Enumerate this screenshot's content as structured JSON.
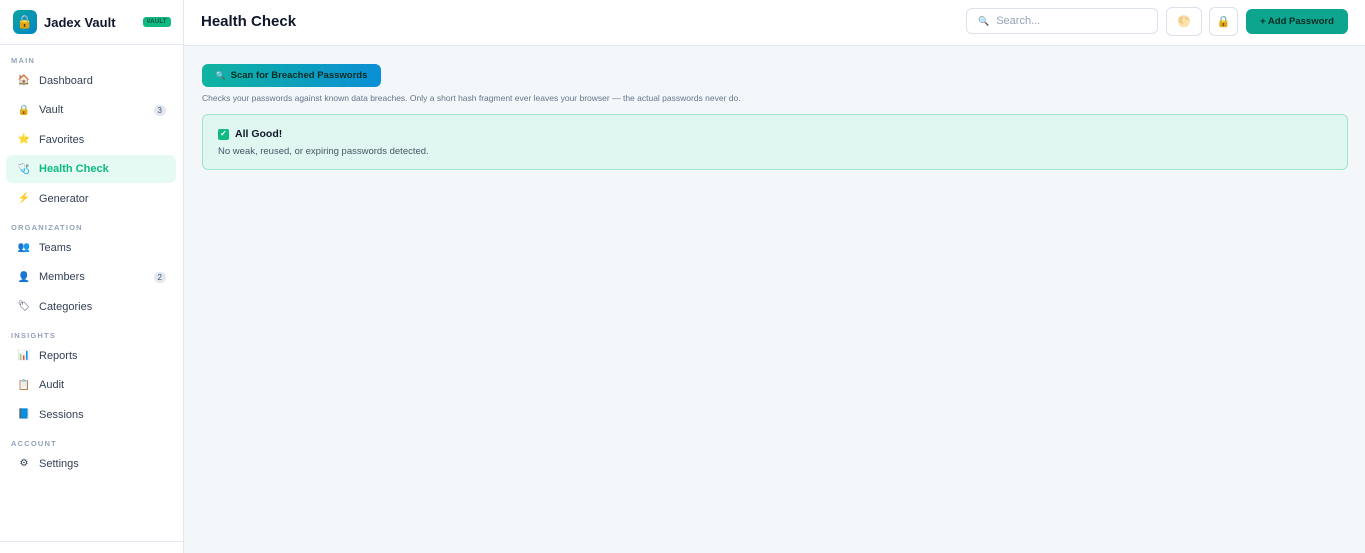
{
  "brand": {
    "name": "Jadex Vault",
    "badge": "VAULT",
    "logo_icon": "🔒"
  },
  "sidebar": {
    "sections": {
      "main": "MAIN",
      "organization": "ORGANIZATION",
      "insights": "INSIGHTS",
      "account": "ACCOUNT"
    },
    "items": {
      "dashboard": {
        "label": "Dashboard",
        "icon": "🏠"
      },
      "vault": {
        "label": "Vault",
        "icon": "🔒",
        "count": "3"
      },
      "favorites": {
        "label": "Favorites",
        "icon": "⭐"
      },
      "health_check": {
        "label": "Health Check",
        "icon": "🩺"
      },
      "generator": {
        "label": "Generator",
        "icon": "⚡"
      },
      "teams": {
        "label": "Teams",
        "icon": "👥"
      },
      "members": {
        "label": "Members",
        "icon": "👤",
        "count": "2"
      },
      "categories": {
        "label": "Categories",
        "icon": "🏷"
      },
      "reports": {
        "label": "Reports",
        "icon": "📊"
      },
      "audit": {
        "label": "Audit",
        "icon": "📋"
      },
      "sessions": {
        "label": "Sessions",
        "icon": "📘"
      },
      "settings": {
        "label": "Settings",
        "icon": "⚙"
      }
    }
  },
  "header": {
    "title": "Health Check",
    "search_placeholder": "Search...",
    "search_icon": "🔍",
    "theme_icon": "🌕",
    "lock_icon": "🔒",
    "add_button_label": "+ Add Password"
  },
  "main": {
    "scan_button_label": "Scan for Breached Passwords",
    "scan_icon": "🔍",
    "helper_text": "Checks your passwords against known data breaches. Only a short hash fragment ever leaves your browser — the actual passwords never do.",
    "result": {
      "title": "All Good!",
      "check_icon": "✓",
      "description": "No weak, reused, or expiring passwords detected."
    }
  },
  "colors": {
    "accent": "#10b981",
    "active_bg": "#e6faf4",
    "result_bg": "#e0f6f0",
    "result_border": "#9ee5cc"
  }
}
